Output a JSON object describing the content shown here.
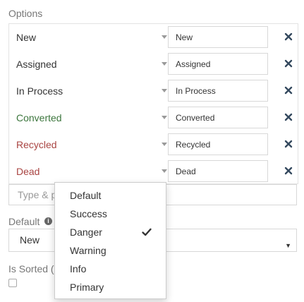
{
  "options_label": "Options",
  "colors": {
    "default": "#333333",
    "success": "#3c763d",
    "danger": "#a94442",
    "remove": "#34495e"
  },
  "options": [
    {
      "select_label": "New",
      "input_value": "New",
      "style": "default"
    },
    {
      "select_label": "Assigned",
      "input_value": "Assigned",
      "style": "default"
    },
    {
      "select_label": "In Process",
      "input_value": "In Process",
      "style": "default"
    },
    {
      "select_label": "Converted",
      "input_value": "Converted",
      "style": "success"
    },
    {
      "select_label": "Recycled",
      "input_value": "Recycled",
      "style": "danger"
    },
    {
      "select_label": "Dead",
      "input_value": "Dead",
      "style": "danger"
    }
  ],
  "add_option_placeholder": "Type & p",
  "default_label": "Default",
  "default_value": "New",
  "is_sorted_label": "Is Sorted (",
  "style_menu": {
    "items": [
      "Default",
      "Success",
      "Danger",
      "Warning",
      "Info",
      "Primary"
    ],
    "selected": "Danger"
  }
}
